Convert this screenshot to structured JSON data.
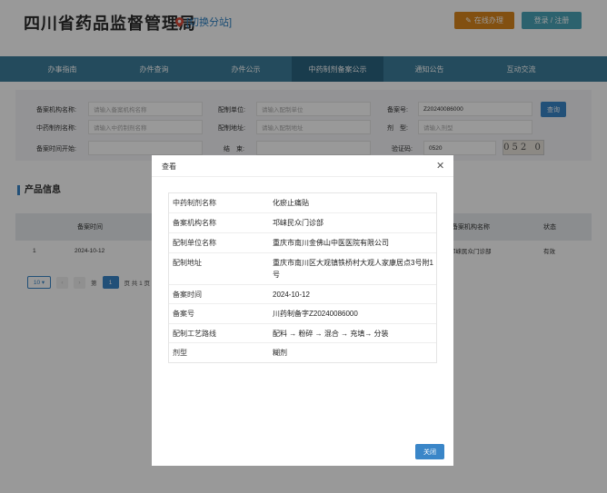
{
  "header": {
    "site_title": "四川省药品监督管理局",
    "switch_label": "[切换分站]",
    "online_btn": "在线办理",
    "login_btn": "登录 / 注册"
  },
  "nav": [
    "办事指南",
    "办件查询",
    "办件公示",
    "中药制剂备案公示",
    "通知公告",
    "互动交流"
  ],
  "nav_active": "中药制剂备案公示",
  "search": {
    "org_name_label": "备案机构名称:",
    "org_name_ph": "请输入备案机构名称",
    "unit_label": "配制单位:",
    "unit_ph": "请输入配制单位",
    "record_no_label": "备案号:",
    "record_no_value": "Z20240086000",
    "query_btn": "查询",
    "prep_name_label": "中药制剂名称:",
    "prep_name_ph": "请输入中药制剂名称",
    "addr_label": "配制地址:",
    "addr_ph": "请输入配制地址",
    "form_label": "剂　型:",
    "form_ph": "请输入剂型",
    "start_label": "备案时间开始:",
    "end_label": "结　束:",
    "captcha_label": "验证码:",
    "captcha_value": "0520",
    "captcha_image": "052 0"
  },
  "product": {
    "title": "产品信息",
    "columns": [
      "备案时间",
      "备案机构名称",
      "状态"
    ],
    "rows": [
      {
        "index": "1",
        "date": "2024-10-12",
        "org": "邛崃民众门诊部",
        "status": "有效"
      }
    ]
  },
  "pager": {
    "size": "10",
    "prefix": "第",
    "current": "1",
    "suffix": "页 共 1 页"
  },
  "modal": {
    "title": "查看",
    "close_btn": "关闭",
    "fields": [
      {
        "key": "中药制剂名称",
        "value": "化瘀止痛贴"
      },
      {
        "key": "备案机构名称",
        "value": "邛崃民众门诊部"
      },
      {
        "key": "配制单位名称",
        "value": "重庆市南川金佛山中医医院有限公司"
      },
      {
        "key": "配制地址",
        "value": "重庆市南川区大观镇铁桥村大观人家康居点3号附1号"
      },
      {
        "key": "备案时间",
        "value": "2024-10-12"
      },
      {
        "key": "备案号",
        "value": "川药制备字Z20240086000"
      },
      {
        "key": "配制工艺路线",
        "value": "配料 → 粉碎 → 混合 → 充填→ 分装"
      },
      {
        "key": "剂型",
        "value": "糊剂"
      }
    ]
  },
  "colors": {
    "nav_bg": "#3d7e9b",
    "nav_active": "#2a6480",
    "accent_blue": "#3a86c8",
    "online_orange": "#d9861d",
    "login_teal": "#4aa3b8"
  }
}
